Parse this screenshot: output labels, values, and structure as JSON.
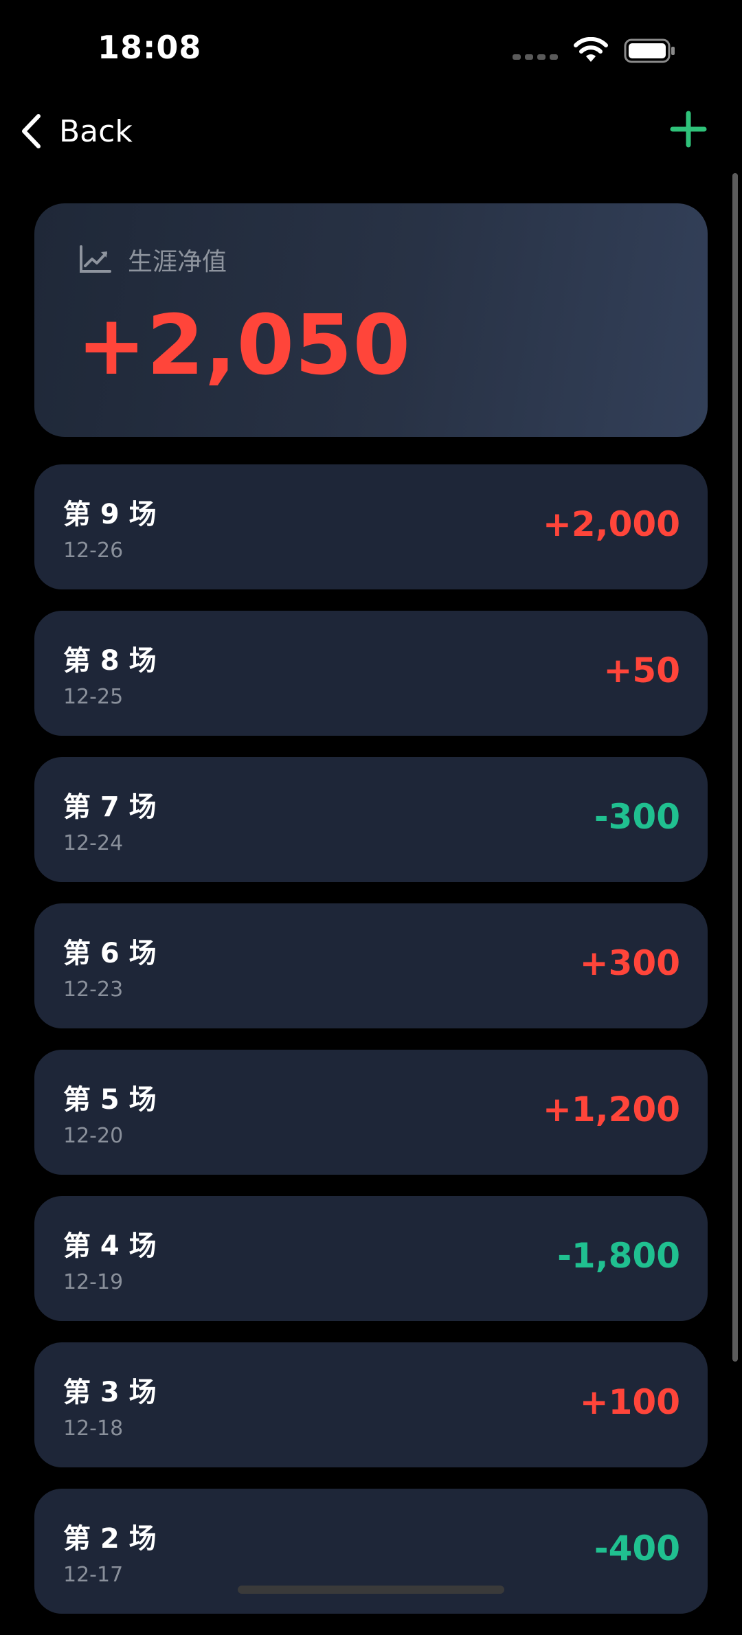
{
  "status_bar": {
    "time": "18:08"
  },
  "nav": {
    "back_label": "Back"
  },
  "summary": {
    "label": "生涯净值",
    "value": "+2,050"
  },
  "sessions": [
    {
      "title": "第 9 场",
      "date": "12-26",
      "amount": "+2,000"
    },
    {
      "title": "第 8 场",
      "date": "12-25",
      "amount": "+50"
    },
    {
      "title": "第 7 场",
      "date": "12-24",
      "amount": "-300"
    },
    {
      "title": "第 6 场",
      "date": "12-23",
      "amount": "+300"
    },
    {
      "title": "第 5 场",
      "date": "12-20",
      "amount": "+1,200"
    },
    {
      "title": "第 4 场",
      "date": "12-19",
      "amount": "-1,800"
    },
    {
      "title": "第 3 场",
      "date": "12-18",
      "amount": "+100"
    },
    {
      "title": "第 2 场",
      "date": "12-17",
      "amount": "-400"
    }
  ],
  "colors": {
    "background": "#000000",
    "card": "#1e2638",
    "gain": "#ff453a",
    "loss": "#20c090",
    "accent": "#2fc27a"
  },
  "icons": {
    "back": "chevron-left-icon",
    "add": "plus-icon",
    "summary": "line-chart-trend-up-icon"
  }
}
